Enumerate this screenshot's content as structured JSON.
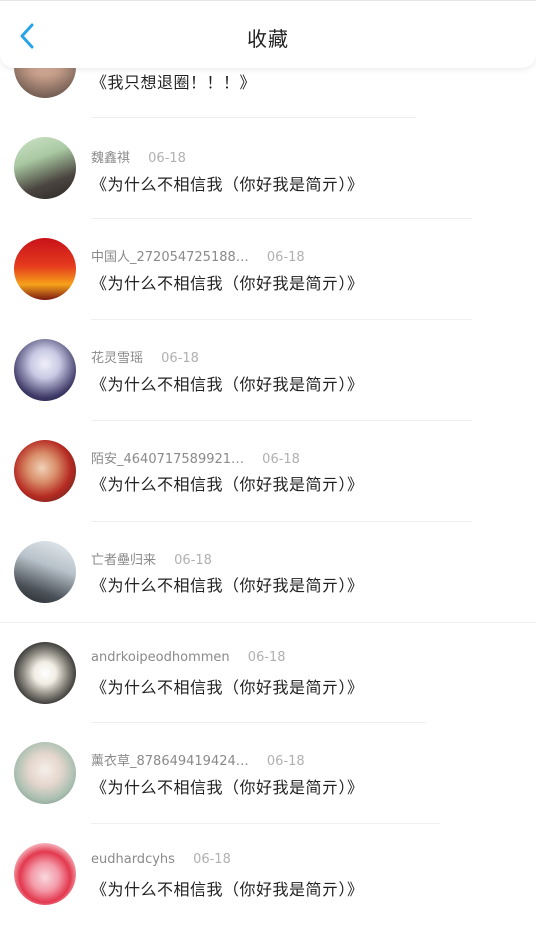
{
  "header": {
    "title": "收藏",
    "back_icon": "chevron-left-icon",
    "accent": "#2aa3e8"
  },
  "items": [
    {
      "user": "",
      "date": "",
      "content": "《我只想退圈！！！》",
      "avatar_colors": [
        "#d9b9a8",
        "#5a4a44"
      ]
    },
    {
      "user": "魏鑫祺",
      "date": "06-18",
      "content": "《为什么不相信我（你好我是简亓）》",
      "avatar_colors": [
        "#b7d6b0",
        "#3c3a36"
      ]
    },
    {
      "user": "中国人_272054725188…",
      "date": "06-18",
      "content": "《为什么不相信我（你好我是简亓）》",
      "avatar_colors": [
        "#e23a1c",
        "#f5c518"
      ]
    },
    {
      "user": "花灵雪瑶",
      "date": "06-18",
      "content": "《为什么不相信我（你好我是简亓）》",
      "avatar_colors": [
        "#2d2a4a",
        "#d8d8ee"
      ]
    },
    {
      "user": "陌安_4640717589921…",
      "date": "06-18",
      "content": "《为什么不相信我（你好我是简亓）》",
      "avatar_colors": [
        "#c23a2c",
        "#3b2a22"
      ]
    },
    {
      "user": "亡者壘归来",
      "date": "06-18",
      "content": "《为什么不相信我（你好我是简亓）》",
      "avatar_colors": [
        "#cfd6dc",
        "#2b2f34"
      ]
    },
    {
      "user": "andrkoipeodhommen",
      "date": "06-18",
      "content": "《为什么不相信我（你好我是简亓）》",
      "avatar_colors": [
        "#1f1f1f",
        "#f2f2f2"
      ]
    },
    {
      "user": "薰衣草_878649419424…",
      "date": "06-18",
      "content": "《为什么不相信我（你好我是简亓）》",
      "avatar_colors": [
        "#e8e2de",
        "#9bb4a4"
      ]
    },
    {
      "user": "eudhardcyhs",
      "date": "06-18",
      "content": "《为什么不相信我（你好我是简亓）》",
      "avatar_colors": [
        "#e8445a",
        "#f6c8d0"
      ]
    }
  ]
}
